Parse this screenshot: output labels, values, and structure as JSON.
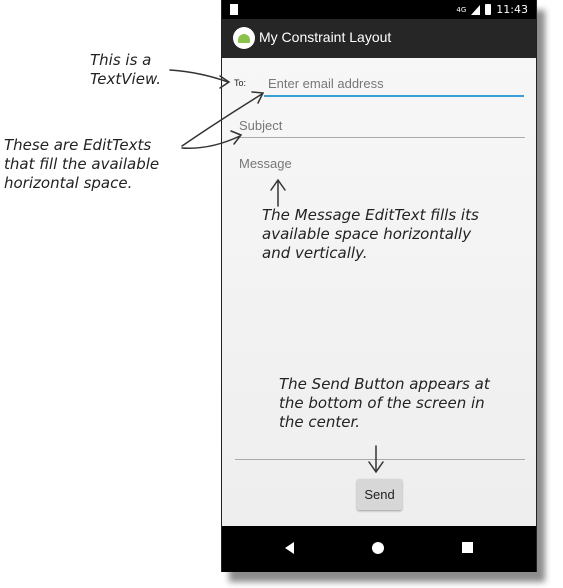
{
  "status_bar": {
    "network": "4G",
    "time": "11:43"
  },
  "app_bar": {
    "title": "My Constraint Layout"
  },
  "form": {
    "to_label": "To:",
    "email_placeholder": "Enter email address",
    "subject_placeholder": "Subject",
    "message_placeholder": "Message",
    "send_label": "Send"
  },
  "annotations": {
    "textview": "This is a TextView.",
    "edittexts": "These are EditTexts that fill the available horizontal space.",
    "message": "The Message EditText fills its available space horizontally and vertically.",
    "send": "The Send Button appears at the bottom of the screen in the center."
  },
  "colors": {
    "accent": "#3a9fd6",
    "app_bar": "#262626",
    "android_green": "#8bc34a"
  }
}
